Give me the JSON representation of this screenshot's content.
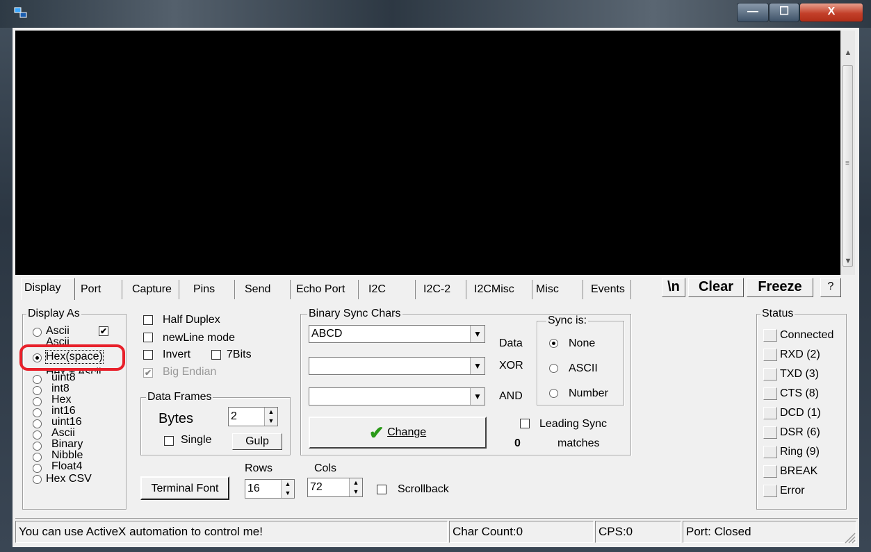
{
  "titlebar": {
    "min_glyph": "—",
    "max_glyph": "☐",
    "close_glyph": "X"
  },
  "scroll": {
    "up": "▲",
    "down": "▼",
    "grip": "≡"
  },
  "tabs": [
    "Display",
    "Port",
    "Capture",
    "Pins",
    "Send",
    "Echo Port",
    "I2C",
    "I2C-2",
    "I2CMisc",
    "Misc",
    "Events"
  ],
  "header_buttons": {
    "newline": "\\n",
    "clear": "Clear",
    "freeze": "Freeze",
    "help": "?"
  },
  "display_as": {
    "title": "Display As",
    "options": [
      "Ascii",
      "Hex(space)",
      "uint8",
      "int8",
      "Hex",
      "int16",
      "uint16",
      "Ascii",
      "Binary",
      "Nibble",
      "Float4",
      "Hex CSV"
    ],
    "selected": "Hex(space)",
    "overlapped_fragments": [
      "Ascii",
      "Hex + Ascii"
    ],
    "ascii_check": "✔"
  },
  "options": {
    "half_duplex": "Half Duplex",
    "newline_mode": "newLine mode",
    "invert": "Invert",
    "seven_bits": "7Bits",
    "big_endian": "Big Endian",
    "big_endian_check": "✔"
  },
  "data_frames": {
    "title": "Data Frames",
    "bytes_label": "Bytes",
    "bytes_value": "2",
    "single": "Single",
    "gulp": "Gulp"
  },
  "binary_sync": {
    "title": "Binary Sync Chars",
    "data_value": "ABCD",
    "data_label": "Data",
    "xor_label": "XOR",
    "and_label": "AND",
    "change": "Change",
    "check_glyph": "✔",
    "leading_sync": "Leading Sync",
    "matches_count": "0",
    "matches": "matches"
  },
  "sync_is": {
    "title": "Sync is:",
    "options": [
      "None",
      "ASCII",
      "Number"
    ],
    "selected": "None"
  },
  "terminal": {
    "font_button": "Terminal Font",
    "rows_label": "Rows",
    "rows_value": "16",
    "cols_label": "Cols",
    "cols_value": "72",
    "scrollback": "Scrollback"
  },
  "status": {
    "title": "Status",
    "items": [
      "Connected",
      "RXD (2)",
      "TXD (3)",
      "CTS (8)",
      "DCD (1)",
      "DSR (6)",
      "Ring (9)",
      "BREAK",
      "Error"
    ]
  },
  "statusbar": {
    "message": "You can use ActiveX automation to control me!",
    "char_count": "Char Count:0",
    "cps": "CPS:0",
    "port": "Port: Closed"
  },
  "colors": {
    "highlight": "#e8202a",
    "terminal_bg": "#000000",
    "change_check": "#2a9a18"
  }
}
